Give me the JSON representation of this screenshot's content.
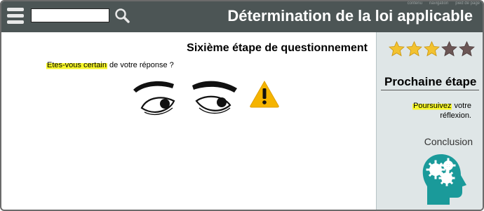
{
  "header": {
    "title": "Détermination de la loi applicable",
    "search": {
      "value": "",
      "placeholder": ""
    },
    "top_links": [
      "contenu",
      "navigation",
      "pied de page"
    ]
  },
  "main": {
    "step_title": "Sixième étape de questionnement",
    "question_highlight": "Etes-vous certain",
    "question_rest": " de votre réponse ?"
  },
  "sidebar": {
    "rating": {
      "filled": 3,
      "total": 5
    },
    "next_heading": "Prochaine étape",
    "next_link": "Poursuivez",
    "next_rest_1": " votre",
    "next_rest_2": "réflexion.",
    "conclusion_label": "Conclusion"
  },
  "colors": {
    "header_bg": "#4c5555",
    "sidebar_bg": "#dfe6e7",
    "highlight": "#f7f72a",
    "star_filled": "#f2c230",
    "star_empty": "#6b5655",
    "warning": "#f5b400",
    "head_icon": "#1a9a9a"
  },
  "icons": [
    "menu-icon",
    "search-icon",
    "star-icon",
    "eyes-illustration",
    "warning-icon",
    "head-gears-icon"
  ]
}
